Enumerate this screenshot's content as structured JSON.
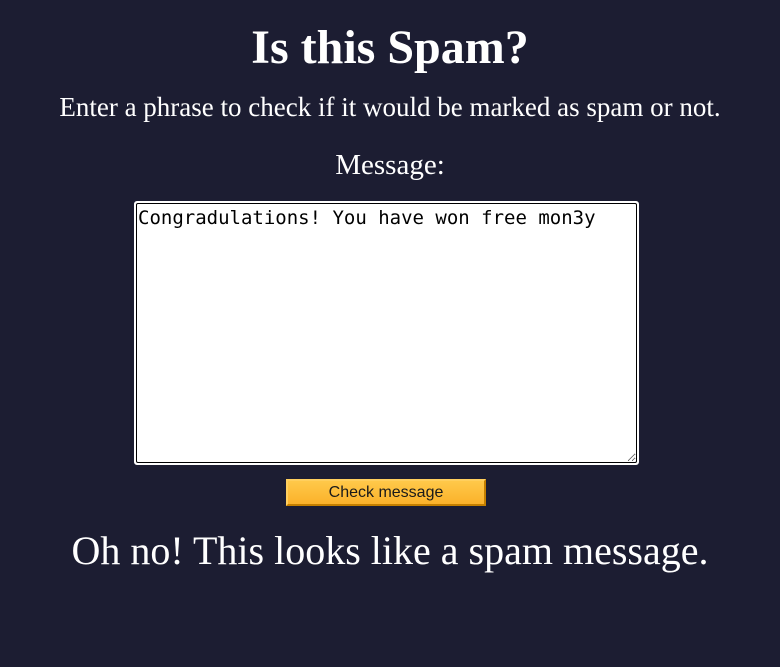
{
  "header": {
    "title": "Is this Spam?",
    "subtitle": "Enter a phrase to check if it would be marked as spam or not."
  },
  "form": {
    "message_label": "Message:",
    "message_value": "Congradulations! You have won free mon3y",
    "check_button_label": "Check message"
  },
  "result": {
    "text": "Oh no! This looks like a spam message."
  },
  "colors": {
    "background": "#1c1d32",
    "text": "#ffffff",
    "button": "#fbb22a"
  }
}
